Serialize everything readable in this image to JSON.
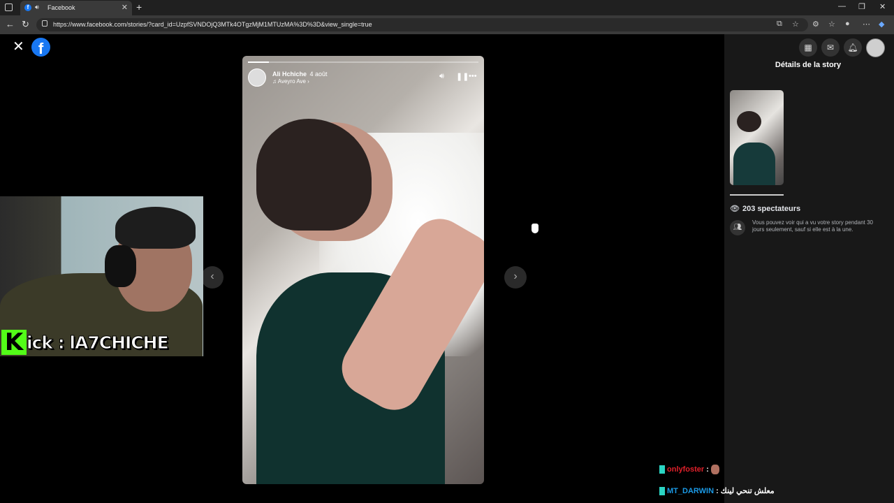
{
  "browser": {
    "tab_title": "Facebook",
    "url": "https://www.facebook.com/stories/?card_id=UzpfSVNDOjQ3MTk4OTgzMjM1MTUzMA%3D%3D&view_single=true",
    "window_controls": [
      "—",
      "❐",
      "✕"
    ]
  },
  "story": {
    "author": "Ali Hchiche",
    "time": "4 août",
    "music": "♫ Aveyro Ave ›"
  },
  "overlay": {
    "kick_letter": "K",
    "kick_text": "ick : lA7CHICHE"
  },
  "panel": {
    "title": "Détails de la story",
    "viewers": "203 spectateurs",
    "info": "Vous pouvez voir qui a vu votre story pendant 30 jours seulement, sauf si elle est à la une."
  },
  "chat": {
    "line1_user": "onlyfoster",
    "line1_sep": " :",
    "line2_user": "MT_DARWIN",
    "line2_sep": " : ",
    "line2_msg": "معلش تنحي لينك"
  },
  "progress": {
    "fraction": 0.09
  },
  "colors": {
    "facebook_blue": "#1877f2",
    "kick_green": "#53fc18",
    "panel_bg": "#181818"
  },
  "icons": [
    "close-icon",
    "facebook-logo",
    "mute-icon",
    "pause-icon",
    "more-icon",
    "chevron-left-icon",
    "chevron-right-icon",
    "grid-icon",
    "messenger-icon",
    "bell-icon",
    "eye-icon",
    "people-icon"
  ]
}
